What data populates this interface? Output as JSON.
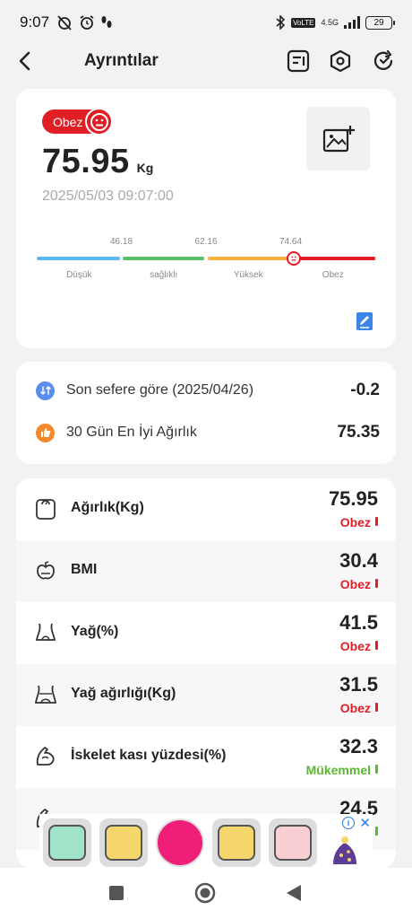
{
  "status_bar": {
    "time": "9:07",
    "volte": "VoLTE",
    "network": "4.5G",
    "battery": "29"
  },
  "header": {
    "title": "Ayrıntılar"
  },
  "summary": {
    "badge": "Obez",
    "weight": "75.95",
    "unit": "Kg",
    "timestamp": "2025/05/03 09:07:00",
    "scale_values": [
      "46.18",
      "62.16",
      "74.64"
    ],
    "scale_labels": [
      "Düşük",
      "sağlıklı",
      "Yüksek",
      "Obez"
    ],
    "scale_colors": [
      "#5bb8ea",
      "#58c068",
      "#f3b23c",
      "#e01e26"
    ],
    "marker_position_fraction": 0.758
  },
  "compare": {
    "rows": [
      {
        "label": "Son sefere göre (2025/04/26)",
        "value": "-0.2",
        "icon": "compare-icon",
        "color": "#5b8def"
      },
      {
        "label": "30 Gün En İyi Ağırlık",
        "value": "75.35",
        "icon": "thumbs-up-icon",
        "color": "#f5882b"
      }
    ]
  },
  "metrics": [
    {
      "label": "Ağırlık(Kg)",
      "value": "75.95",
      "status": "Obez",
      "status_color": "#e01e26",
      "icon": "scale-icon"
    },
    {
      "label": "BMI",
      "value": "30.4",
      "status": "Obez",
      "status_color": "#e01e26",
      "icon": "bmi-icon"
    },
    {
      "label": "Yağ(%)",
      "value": "41.5",
      "status": "Obez",
      "status_color": "#e01e26",
      "icon": "body-fat-icon"
    },
    {
      "label": "Yağ ağırlığı(Kg)",
      "value": "31.5",
      "status": "Obez",
      "status_color": "#e01e26",
      "icon": "fat-weight-icon"
    },
    {
      "label": "İskelet kası yüzdesi(%)",
      "value": "32.3",
      "status": "Mükemmel",
      "status_color": "#5cb82e",
      "icon": "muscle-icon"
    },
    {
      "label": "",
      "value": "24.5",
      "status": "",
      "status_color": "#5cb82e",
      "icon": "muscle-weight-icon"
    }
  ],
  "ad": {
    "info": "i",
    "close": "✕",
    "item_colors": [
      "#9fe3c8",
      "#f5d66b",
      "#ee1e79",
      "#f5d66b",
      "#f9cfd3"
    ]
  }
}
